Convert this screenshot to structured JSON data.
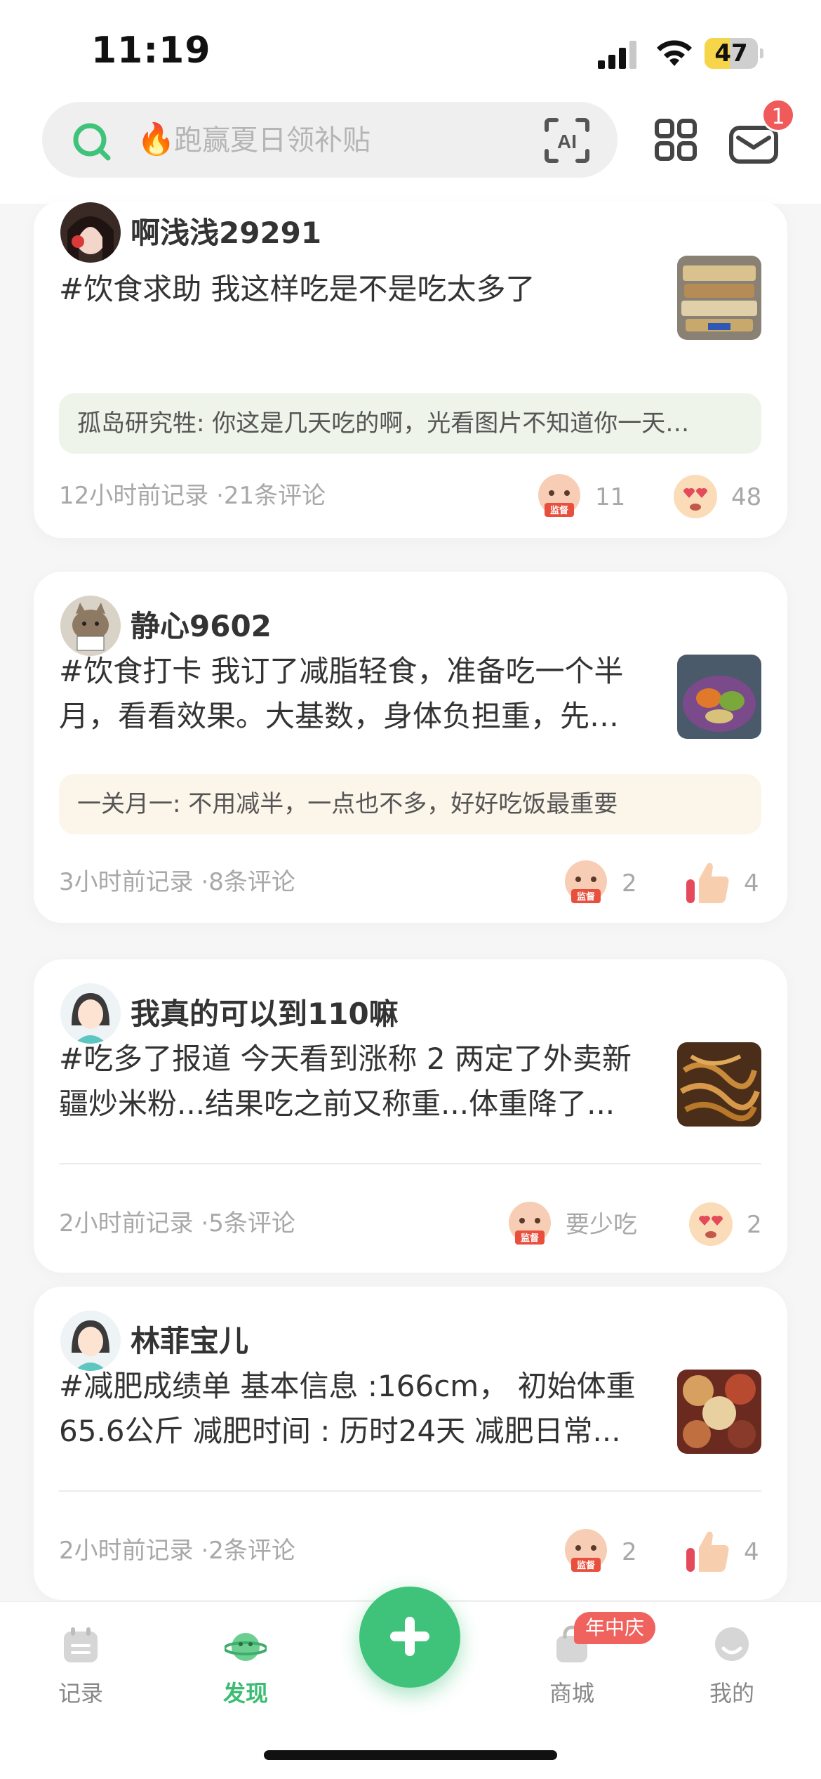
{
  "status_bar": {
    "time": "11:19",
    "battery": "47",
    "battery_level": 0.47
  },
  "search": {
    "fire_icon": "🔥",
    "placeholder": "跑赢夏日领补贴"
  },
  "header": {
    "mail_badge": "1"
  },
  "posts": [
    {
      "username": "啊浅浅29291",
      "text": "#饮食求助 我这样吃是不是吃太多了",
      "comment": "孤岛研究牲: 你这是几天吃的啊，光看图片不知道你一天…",
      "meta": "12小时前记录 ·21条评论",
      "supervise_count": "11",
      "reaction_count": "48"
    },
    {
      "username": "静心9602",
      "text": "#饮食打卡 我订了减脂轻食，准备吃一个半月，看看效果。大基数，身体负担重，先…",
      "comment": "一关月一: 不用减半，一点也不多，好好吃饭最重要",
      "meta": "3小时前记录 ·8条评论",
      "supervise_count": "2",
      "reaction_count": "4"
    },
    {
      "username": "我真的可以到110嘛",
      "text": "#吃多了报道 今天看到涨称 2 两定了外卖新疆炒米粉...结果吃之前又称重...体重降了...",
      "meta": "2小时前记录 ·5条评论",
      "supervise_count": "要少吃",
      "reaction_count": "2"
    },
    {
      "username": "林菲宝儿",
      "text": "#减肥成绩单 基本信息 :166cm， 初始体重65.6公斤 减肥时间 : 历时24天 减肥日常...",
      "meta": "2小时前记录 ·2条评论",
      "supervise_count": "2",
      "reaction_count": "4"
    }
  ],
  "tabs": [
    {
      "label": "记录",
      "icon": "calendar-icon"
    },
    {
      "label": "发现",
      "icon": "planet-icon"
    },
    {
      "label": "商城",
      "icon": "shop-bag-icon",
      "badge": "年中庆"
    },
    {
      "label": "我的",
      "icon": "profile-icon"
    }
  ],
  "colors": {
    "accent": "#3fc37a",
    "badge_red": "#f05a5a"
  }
}
